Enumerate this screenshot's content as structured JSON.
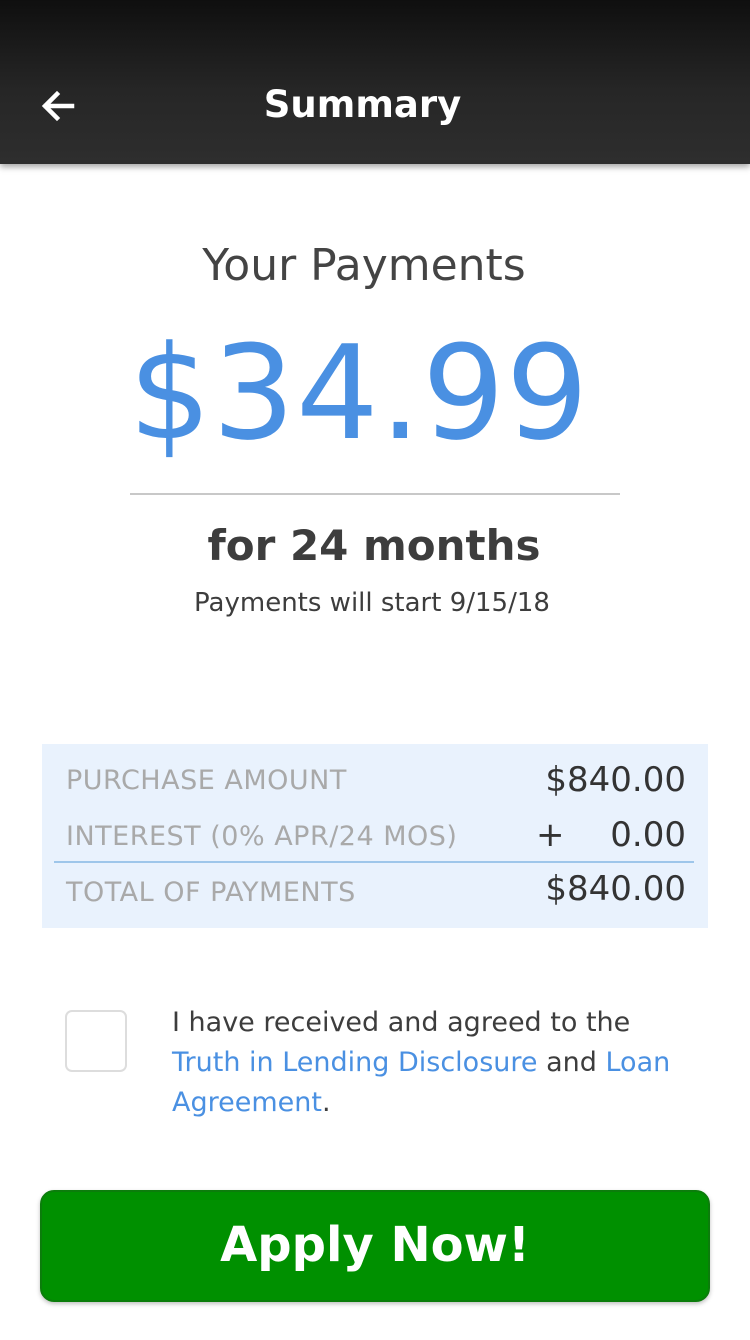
{
  "header": {
    "title": "Summary",
    "back_icon": "arrow-left-icon"
  },
  "payment": {
    "heading": "Your Payments",
    "amount": "$34.99",
    "term": "for 24 months",
    "start_note": "Payments will start 9/15/18"
  },
  "breakdown": {
    "rows": [
      {
        "label": "PURCHASE AMOUNT",
        "prefix": "",
        "value": "$840.00"
      },
      {
        "label": "INTEREST (0% APR/24 MOS)",
        "prefix": "+",
        "value": "0.00"
      },
      {
        "label": "TOTAL OF PAYMENTS",
        "prefix": "",
        "value": "$840.00"
      }
    ]
  },
  "agreement": {
    "checked": false,
    "text_before": "I have received and agreed to the ",
    "link_disclosure": "Truth in Lending Disclosure",
    "text_middle": " and ",
    "link_agreement": "Loan Agreement",
    "text_after": "."
  },
  "actions": {
    "apply_label": "Apply Now!"
  },
  "colors": {
    "accent_blue": "#4a90e2",
    "button_green": "#009000",
    "box_bg": "#e9f2fd"
  }
}
